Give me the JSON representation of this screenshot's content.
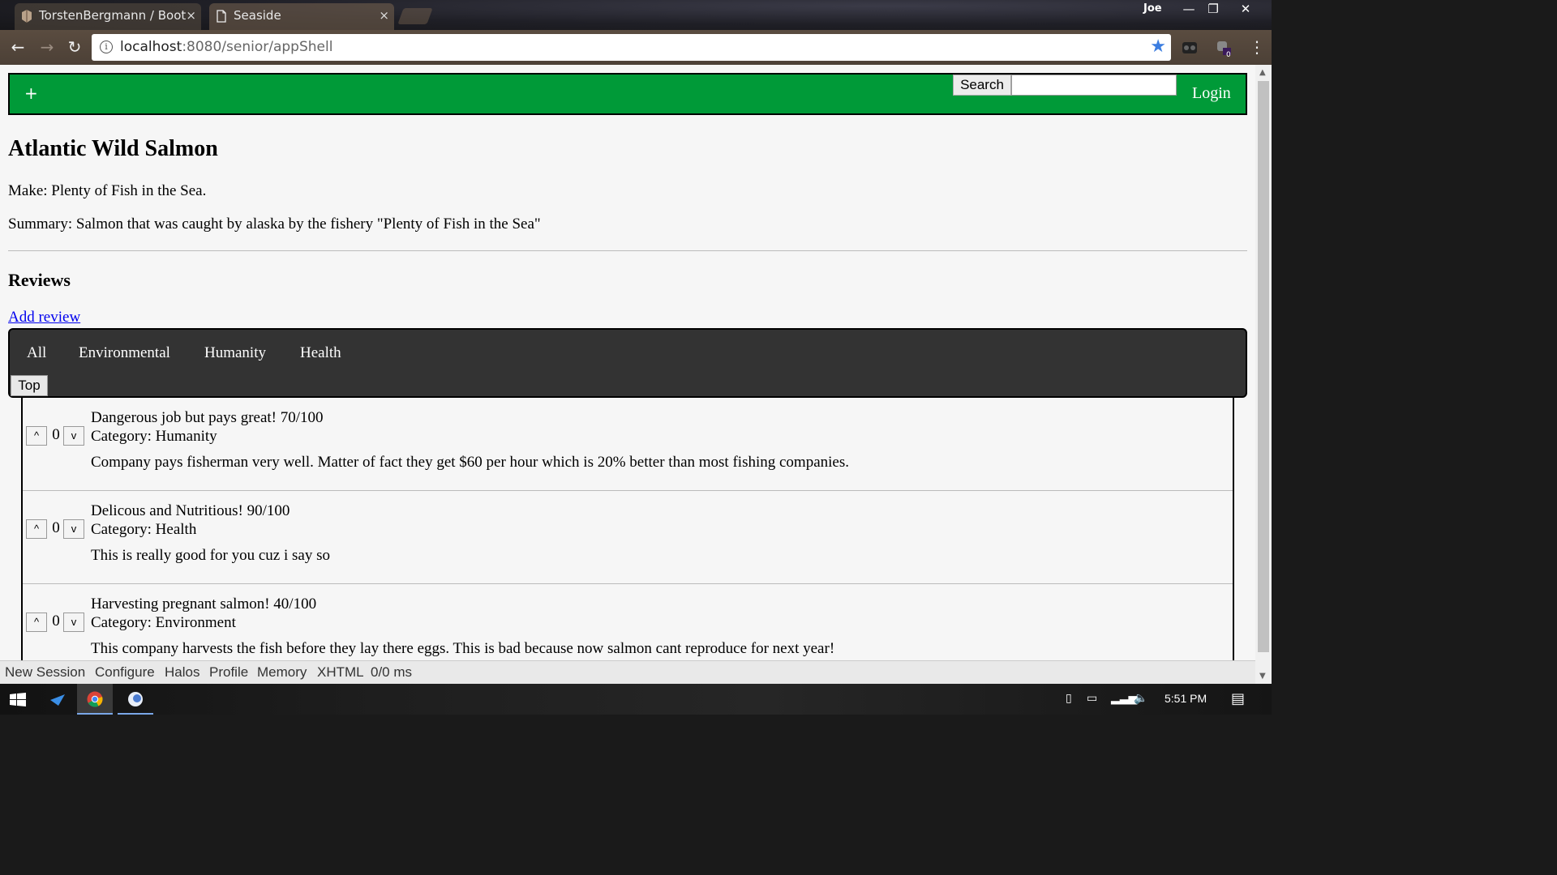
{
  "browser": {
    "tabs": [
      {
        "label": "TorstenBergmann / Boot",
        "close": "×"
      },
      {
        "label": "Seaside",
        "close": "×"
      }
    ],
    "profile_name": "Joe",
    "window_controls": {
      "minimize": "—",
      "restore": "❐",
      "close": "✕"
    },
    "nav": {
      "back": "←",
      "forward": "→",
      "reload": "↻"
    },
    "url_host": "localhost",
    "url_rest": ":8080/senior/appShell",
    "info_glyph": "i",
    "star": "★",
    "extension_badge": "0",
    "menu": "⋮"
  },
  "header": {
    "plus": "+",
    "search_button": "Search",
    "search_value": "",
    "login": "Login"
  },
  "product": {
    "title": "Atlantic Wild Salmon",
    "make": "Make: Plenty of Fish in the Sea.",
    "summary": "Summary: Salmon that was caught by alaska by the fishery \"Plenty of Fish in the Sea\""
  },
  "reviews": {
    "heading": "Reviews",
    "add_review": "Add review",
    "filters": [
      "All",
      "Environmental",
      "Humanity",
      "Health"
    ],
    "sort_button": "Top",
    "items": [
      {
        "up": "^",
        "count": "0",
        "down": "v",
        "title": "Dangerous job but pays great! 70/100",
        "category": "Category: Humanity",
        "body": "Company pays fisherman very well. Matter of fact they get $60 per hour which is 20% better than most fishing companies."
      },
      {
        "up": "^",
        "count": "0",
        "down": "v",
        "title": "Delicous and Nutritious! 90/100",
        "category": "Category: Health",
        "body": "This is really good for you cuz i say so"
      },
      {
        "up": "^",
        "count": "0",
        "down": "v",
        "title": "Harvesting pregnant salmon! 40/100",
        "category": "Category: Environment",
        "body": "This company harvests the fish before they lay there eggs. This is bad because now salmon cant reproduce for next year!"
      }
    ]
  },
  "dev_toolbar": [
    "New Session",
    "Configure",
    "Halos",
    "Profile",
    "Memory",
    "XHTML",
    "0/0 ms"
  ],
  "taskbar": {
    "clock": "5:51 PM"
  },
  "colors": {
    "header_green": "#009a38",
    "filter_bar": "#333333",
    "link_blue": "#0000ee",
    "star_blue": "#3b7de0"
  }
}
